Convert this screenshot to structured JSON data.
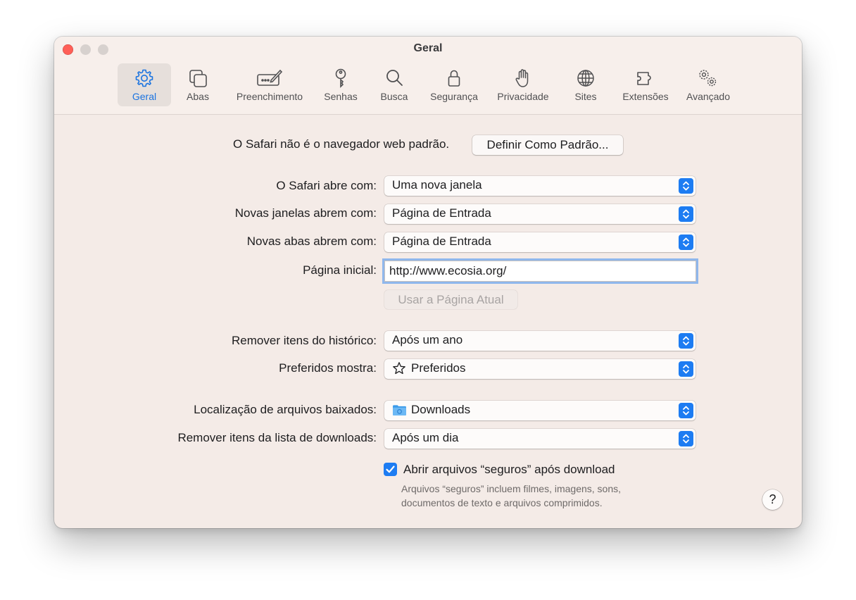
{
  "window": {
    "title": "Geral"
  },
  "toolbar": {
    "tabs": [
      {
        "label": "Geral",
        "icon": "gear-icon",
        "active": true
      },
      {
        "label": "Abas",
        "icon": "tabs-icon"
      },
      {
        "label": "Preenchimento",
        "icon": "autofill-icon"
      },
      {
        "label": "Senhas",
        "icon": "key-icon"
      },
      {
        "label": "Busca",
        "icon": "search-icon"
      },
      {
        "label": "Segurança",
        "icon": "lock-icon"
      },
      {
        "label": "Privacidade",
        "icon": "hand-icon"
      },
      {
        "label": "Sites",
        "icon": "globe-icon"
      },
      {
        "label": "Extensões",
        "icon": "puzzle-icon"
      },
      {
        "label": "Avançado",
        "icon": "gears-icon"
      }
    ]
  },
  "default_browser": {
    "message": "O Safari não é o navegador web padrão.",
    "button": "Definir Como Padrão..."
  },
  "settings": {
    "opens_with": {
      "label": "O Safari abre com:",
      "value": "Uma nova janela"
    },
    "new_windows": {
      "label": "Novas janelas abrem com:",
      "value": "Página de Entrada"
    },
    "new_tabs": {
      "label": "Novas abas abrem com:",
      "value": "Página de Entrada"
    },
    "homepage": {
      "label": "Página inicial:",
      "value": "http://www.ecosia.org/"
    },
    "use_current_page": "Usar a Página Atual",
    "remove_history": {
      "label": "Remover itens do histórico:",
      "value": "Após um ano"
    },
    "favorites_shows": {
      "label": "Preferidos mostra:",
      "value": "Preferidos",
      "icon": "star-icon"
    },
    "download_location": {
      "label": "Localização de arquivos baixados:",
      "value": "Downloads",
      "icon": "folder-icon"
    },
    "remove_downloads": {
      "label": "Remover itens da lista de downloads:",
      "value": "Após um dia"
    },
    "open_safe_files": {
      "label": "Abrir arquivos “seguros” após download",
      "checked": true,
      "hint_line1": "Arquivos “seguros” incluem filmes, imagens, sons,",
      "hint_line2": "documentos de texto e arquivos comprimidos."
    },
    "help": "?"
  },
  "colors": {
    "accent": "#1d7cf2",
    "close": "#ff5f57",
    "window_bg": "#f4ebe7"
  }
}
